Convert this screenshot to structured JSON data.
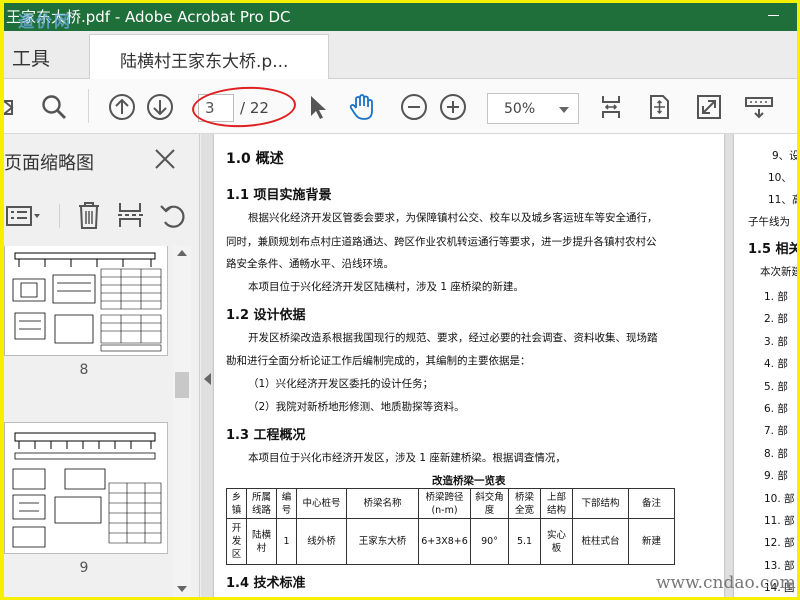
{
  "window": {
    "title": "王家东大桥.pdf - Adobe Acrobat Pro DC"
  },
  "watermarks": {
    "top": "造价网",
    "bottom": "www.cndao.com"
  },
  "tabs": {
    "tools": "工具",
    "document": "陆横村王家东大桥.p..."
  },
  "toolbar": {
    "page_current": "3",
    "page_total": "/ 22",
    "zoom": "50%",
    "icons": [
      "print-icon",
      "search-icon",
      "page-up-icon",
      "page-down-icon",
      "select-arrow-icon",
      "hand-tool-icon",
      "zoom-out-icon",
      "zoom-in-icon",
      "fit-width-icon",
      "fit-page-icon",
      "fullscreen-icon",
      "keyboard-icon"
    ],
    "hand_tool_color": "#1a73c8",
    "highlight_color": "#e02020"
  },
  "sidebar": {
    "title": "页面缩略图",
    "thumbnails": [
      {
        "page": "8"
      },
      {
        "page": "9"
      }
    ]
  },
  "document": {
    "heading_main": "1.0 概述",
    "sec_1_1": "1.1  项目实施背景",
    "p_1_1_a": "根据兴化经济开发区管委会要求，为保障镇村公交、校车以及城乡客运班车等安全通行，",
    "p_1_1_b": "同时，兼顾规划布点村庄道路通达、跨区作业农机转运通行等要求，进一步提升各镇村农村公",
    "p_1_1_c": "路安全条件、通畅水平、沿线环境。",
    "p_1_1_d": "本项目位于兴化经济开发区陆横村，涉及 1 座桥梁的新建。",
    "sec_1_2": "1.2  设计依据",
    "p_1_2_a": "开发区桥梁改造系根据我国现行的规范、要求，经过必要的社会调查、资料收集、现场踏",
    "p_1_2_b": "勘和进行全面分析论证工作后编制完成的，其编制的主要依据是：",
    "p_1_2_c": "（1）兴化经济开发区委托的设计任务；",
    "p_1_2_d": "（2）我院对新桥地形修测、地质勘探等资料。",
    "sec_1_3": "1.3  工程概况",
    "p_1_3_a": "本项目位于兴化市经济开发区，涉及 1 座新建桥梁。根据调查情况，",
    "table_title": "改造桥梁一览表",
    "table_headers": [
      "乡镇",
      "所属线路",
      "编号",
      "中心桩号",
      "桥梁名称",
      "桥梁跨径(n-m)",
      "斜交角度",
      "桥梁全宽",
      "上部结构",
      "下部结构",
      "备注"
    ],
    "table_row": [
      "开发区",
      "陆横村",
      "1",
      "线外桥",
      "王家东大桥",
      "6+3X8+6",
      "90°",
      "5.1",
      "实心板",
      "桩柱式台",
      "新建"
    ],
    "sec_1_4": "1.4  技术标准"
  },
  "next_page": {
    "items_top": [
      "9、设",
      "10、",
      "11、高"
    ],
    "line_a": "子午线为",
    "sec_1_5": "1.5  相关",
    "line_b": "本次新建",
    "items": [
      "1. 部",
      "2. 部",
      "3. 部",
      "4. 部",
      "5. 部",
      "6. 部",
      "7. 部",
      "8. 部",
      "9. 部",
      "10. 部",
      "11. 部",
      "12. 部",
      "13. 部",
      "14. 国"
    ]
  }
}
